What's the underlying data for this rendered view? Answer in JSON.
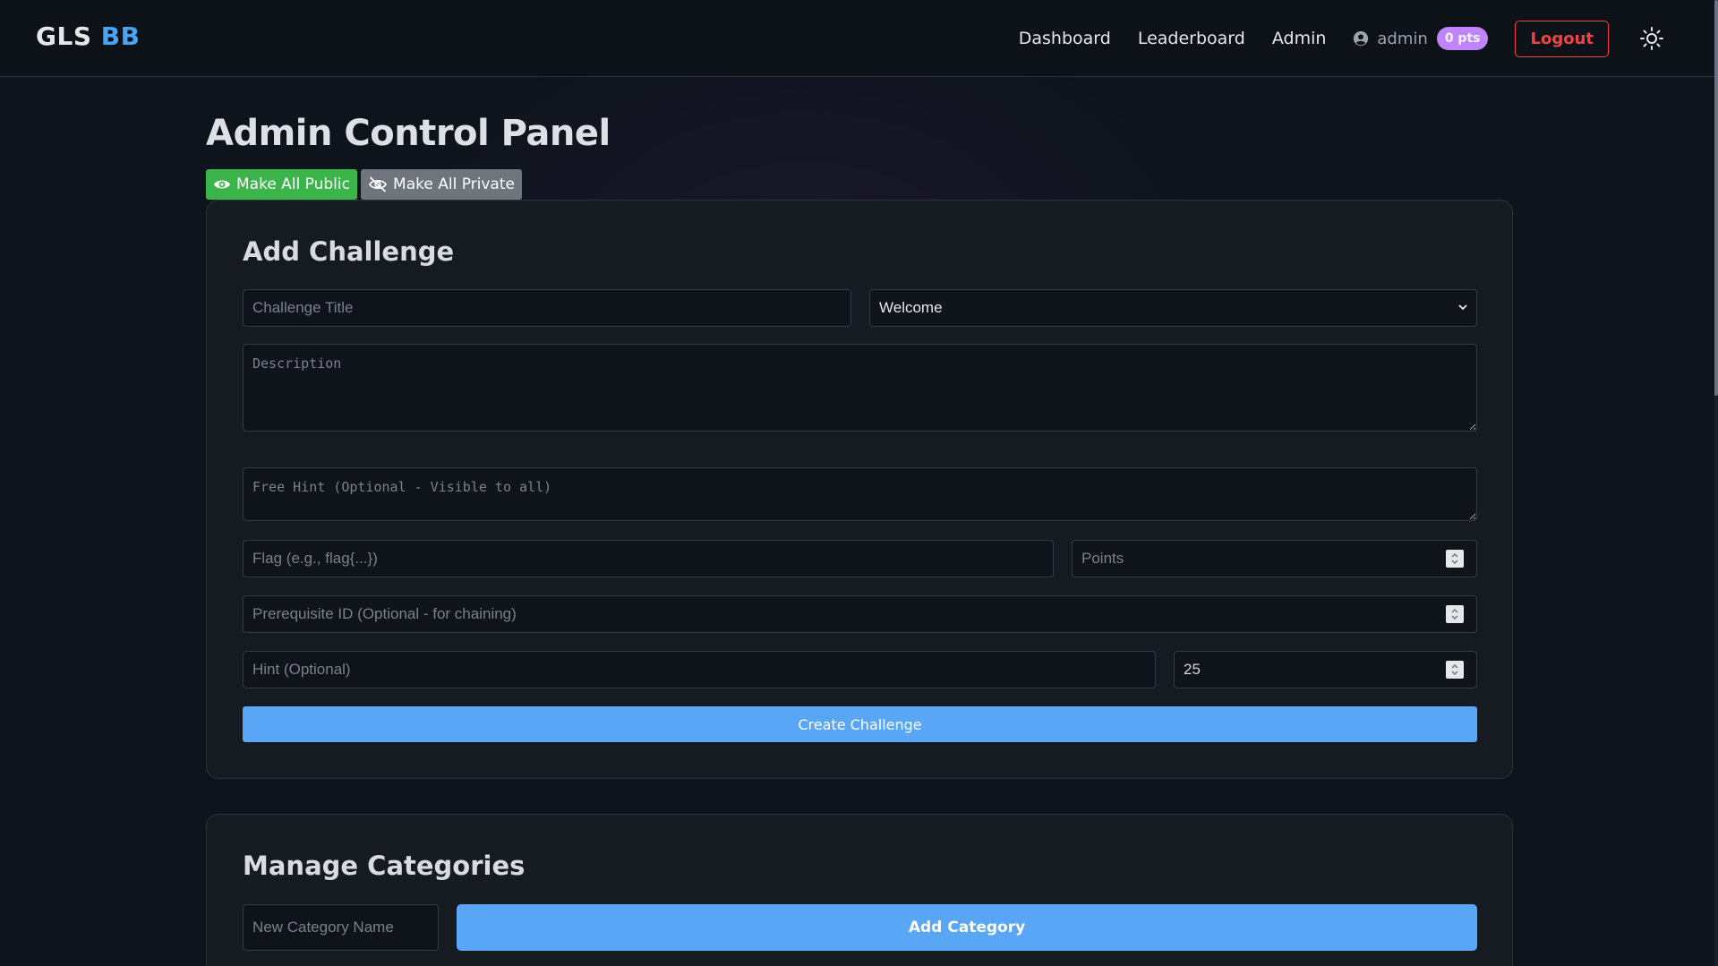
{
  "brand": {
    "part1": "GLS",
    "part2": "BB"
  },
  "nav": {
    "dashboard": "Dashboard",
    "leaderboard": "Leaderboard",
    "admin": "Admin",
    "username": "admin",
    "points": "0 pts",
    "logout": "Logout"
  },
  "page": {
    "title": "Admin Control Panel",
    "make_public": "Make All Public",
    "make_private": "Make All Private"
  },
  "add_challenge": {
    "title": "Add Challenge",
    "title_placeholder": "Challenge Title",
    "category_selected": "Welcome",
    "description_placeholder": "Description",
    "free_hint_placeholder": "Free Hint (Optional - Visible to all)",
    "flag_placeholder": "Flag (e.g., flag{...})",
    "points_placeholder": "Points",
    "prereq_placeholder": "Prerequisite ID (Optional - for chaining)",
    "hint_placeholder": "Hint (Optional)",
    "hint_cost_value": "25",
    "create_button": "Create Challenge"
  },
  "manage_categories": {
    "title": "Manage Categories",
    "new_category_placeholder": "New Category Name",
    "add_button": "Add Category"
  },
  "colors": {
    "accent": "#58a6f5",
    "success": "#3bb54a",
    "danger": "#ef4444",
    "badge": "#c084fc"
  }
}
